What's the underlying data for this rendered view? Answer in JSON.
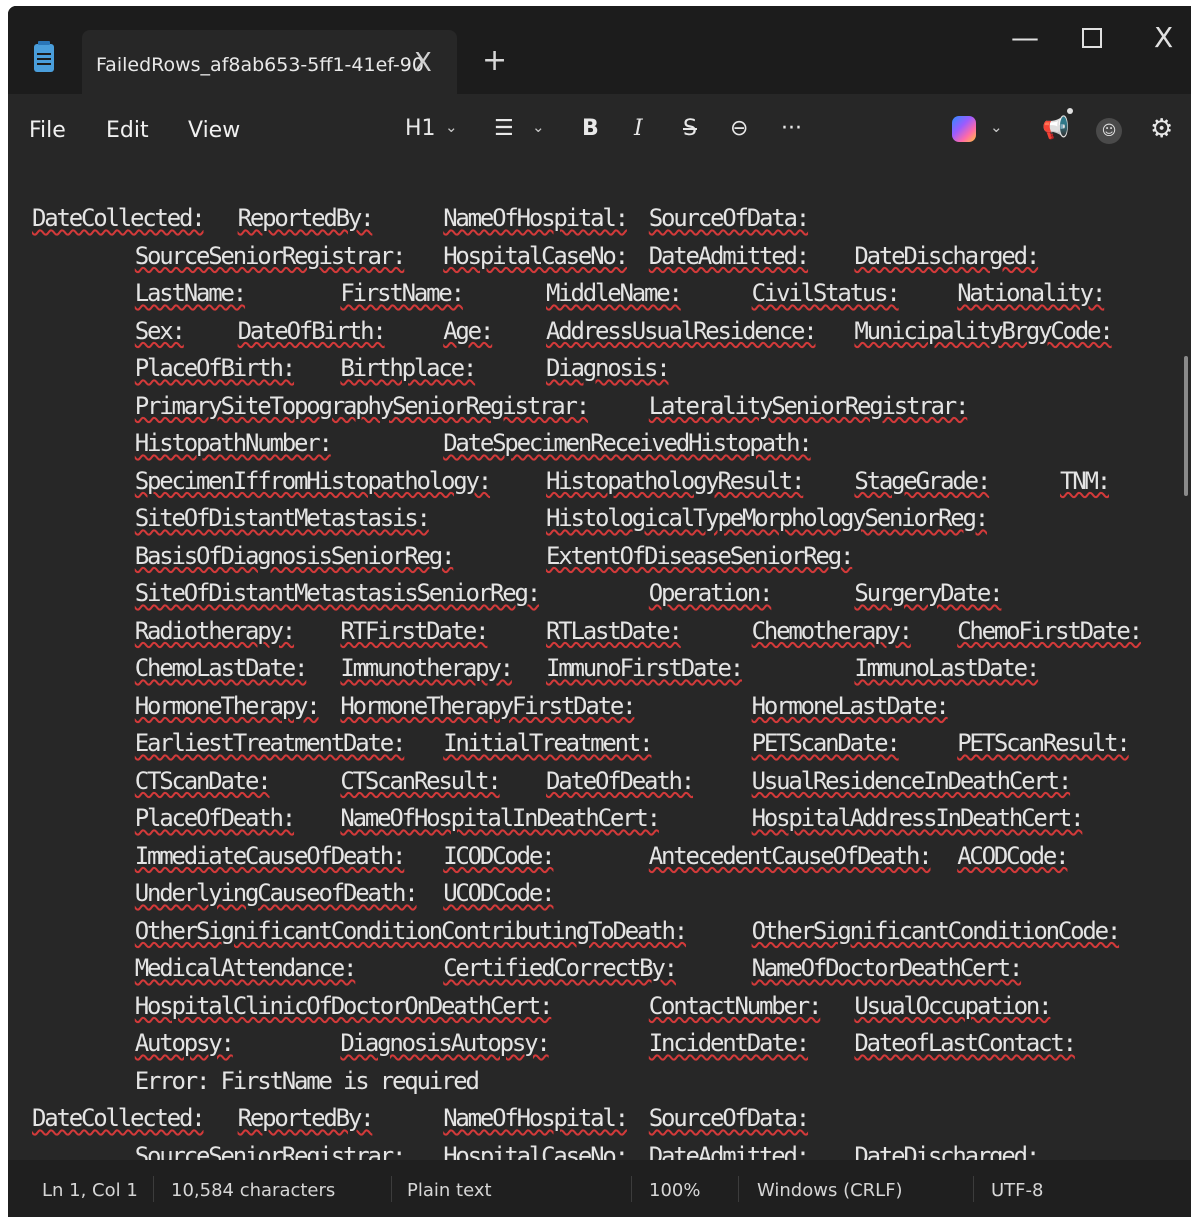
{
  "tab": {
    "title": "FailedRows_af8ab653-5ff1-41ef-90",
    "close_glyph": "X",
    "new_tab_glyph": "+"
  },
  "window": {
    "minimize_glyph": "—",
    "close_glyph": "X"
  },
  "menu": {
    "file": "File",
    "edit": "Edit",
    "view": "View"
  },
  "toolbar": {
    "heading": "H1",
    "chevron": "⌄",
    "list_glyph": "☰",
    "bold": "B",
    "italic": "I",
    "strike": "S",
    "link_glyph": "⊖",
    "more": "···",
    "announce_glyph": "📢",
    "account_glyph": "☺",
    "settings_glyph": "⚙"
  },
  "editor": {
    "lines": [
      [
        "DateCollected:",
        "ReportedBy:",
        "NameOfHospital:",
        "SourceOfData:"
      ],
      [
        "SourceSeniorRegistrar:",
        "HospitalCaseNo:",
        "DateAdmitted:",
        "DateDischarged:"
      ],
      [
        "LastName:",
        "FirstName:",
        "MiddleName:",
        "CivilStatus:",
        "Nationality:"
      ],
      [
        "Sex:",
        "DateOfBirth:",
        "Age:",
        "AddressUsualResidence:",
        "MunicipalityBrgyCode:"
      ],
      [
        "PlaceOfBirth:",
        "Birthplace:",
        "Diagnosis:"
      ],
      [
        "PrimarySiteTopographySeniorRegistrar:",
        "LateralitySeniorRegistrar:"
      ],
      [
        "HistopathNumber:",
        "DateSpecimenReceivedHistopath:"
      ],
      [
        "SpecimenIffromHistopathology:",
        "HistopathologyResult:",
        "StageGrade:",
        "TNM:"
      ],
      [
        "SiteOfDistantMetastasis:",
        "HistologicalTypeMorphologySeniorReg:"
      ],
      [
        "BasisOfDiagnosisSeniorReg:",
        "ExtentOfDiseaseSeniorReg:"
      ],
      [
        "SiteOfDistantMetastasisSeniorReg:",
        "Operation:",
        "SurgeryDate:"
      ],
      [
        "Radiotherapy:",
        "RTFirstDate:",
        "RTLastDate:",
        "Chemotherapy:",
        "ChemoFirstDate:"
      ],
      [
        "ChemoLastDate:",
        "Immunotherapy:",
        "ImmunoFirstDate:",
        "ImmunoLastDate:"
      ],
      [
        "HormoneTherapy:",
        "HormoneTherapyFirstDate:",
        "HormoneLastDate:"
      ],
      [
        "EarliestTreatmentDate:",
        "InitialTreatment:",
        "PETScanDate:",
        "PETScanResult:"
      ],
      [
        "CTScanDate:",
        "CTScanResult:",
        "DateOfDeath:",
        "UsualResidenceInDeathCert:"
      ],
      [
        "PlaceOfDeath:",
        "NameOfHospitalInDeathCert:",
        "HospitalAddressInDeathCert:"
      ],
      [
        "ImmediateCauseOfDeath:",
        "ICODCode:",
        "AntecedentCauseOfDeath:",
        "ACODCode:"
      ],
      [
        "UnderlyingCauseofDeath:",
        "UCODCode:"
      ],
      [
        "OtherSignificantConditionContributingToDeath:",
        "OtherSignificantConditionCode:"
      ],
      [
        "MedicalAttendance:",
        "CertifiedCorrectBy:",
        "NameOfDoctorDeathCert:"
      ],
      [
        "HospitalClinicOfDoctorOnDeathCert:",
        "ContactNumber:",
        "UsualOccupation:"
      ],
      [
        "Autopsy:",
        "DiagnosisAutopsy:",
        "IncidentDate:",
        "DateofLastContact:"
      ],
      [
        "Error: FirstName is required"
      ],
      [
        "DateCollected:",
        "ReportedBy:",
        "NameOfHospital:",
        "SourceOfData:"
      ],
      [
        "SourceSeniorRegistrar:",
        "HospitalCaseNo:",
        "DateAdmitted:",
        "DateDischarged:"
      ]
    ]
  },
  "status": {
    "position": "Ln 1, Col 1",
    "characters": "10,584 characters",
    "format": "Plain text",
    "zoom": "100%",
    "line_ending": "Windows (CRLF)",
    "encoding": "UTF-8"
  }
}
